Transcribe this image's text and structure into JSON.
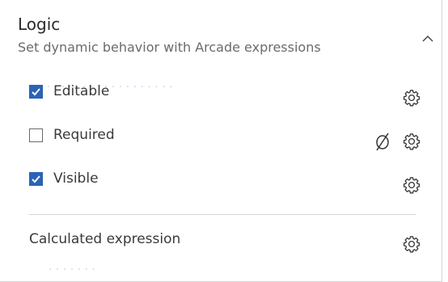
{
  "header": {
    "title": "Logic",
    "subtitle": "Set dynamic behavior with Arcade expressions"
  },
  "rows": [
    {
      "label": "Editable",
      "checked": true,
      "icons": [
        "gear-icon"
      ]
    },
    {
      "label": "Required",
      "checked": false,
      "icons": [
        "null-icon",
        "gear-icon"
      ]
    },
    {
      "label": "Visible",
      "checked": true,
      "icons": [
        "gear-icon"
      ]
    }
  ],
  "calculated": {
    "label": "Calculated expression",
    "icons": [
      "gear-icon"
    ]
  },
  "colors": {
    "accent": "#2b63b5",
    "text": "#323232",
    "muted": "#6b6b6b",
    "divider": "#d3d3d3"
  }
}
